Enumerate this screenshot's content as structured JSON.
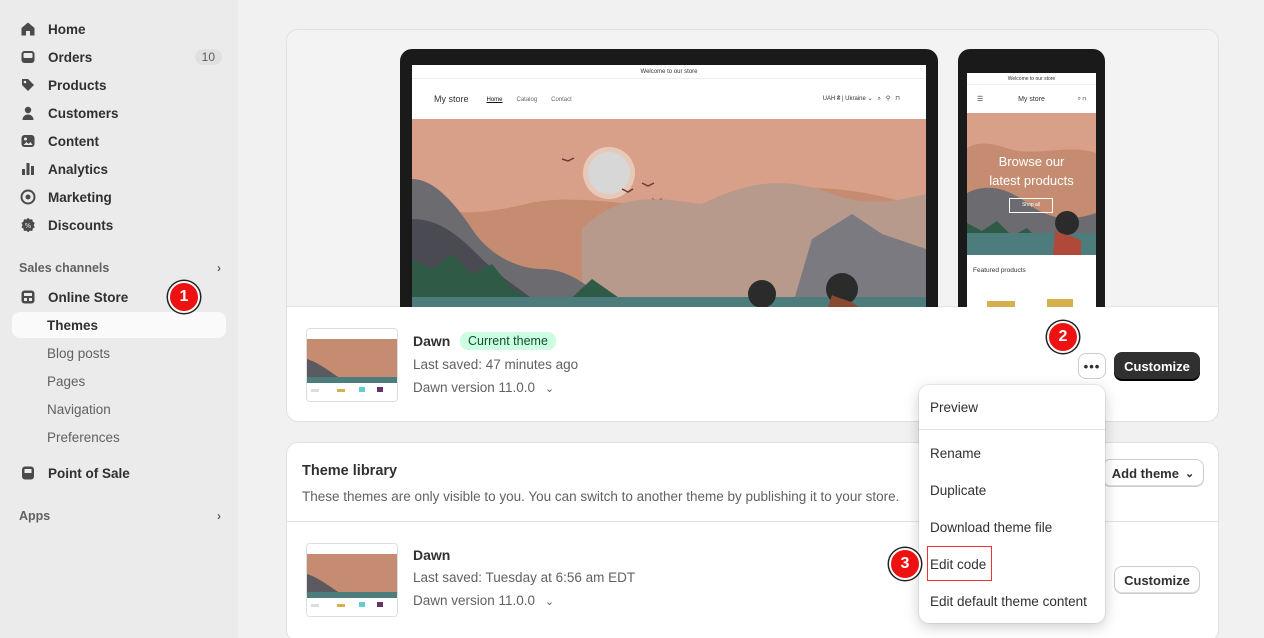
{
  "sidebar": {
    "items": [
      {
        "label": "Home",
        "icon": "home-icon"
      },
      {
        "label": "Orders",
        "icon": "inbox-icon",
        "badge": "10"
      },
      {
        "label": "Products",
        "icon": "tag-icon"
      },
      {
        "label": "Customers",
        "icon": "person-icon"
      },
      {
        "label": "Content",
        "icon": "image-icon"
      },
      {
        "label": "Analytics",
        "icon": "bar-chart-icon"
      },
      {
        "label": "Marketing",
        "icon": "target-icon"
      },
      {
        "label": "Discounts",
        "icon": "discount-icon"
      }
    ],
    "sales_channels_label": "Sales channels",
    "online_store_label": "Online Store",
    "sub_items": [
      "Themes",
      "Blog posts",
      "Pages",
      "Navigation",
      "Preferences"
    ],
    "pos_label": "Point of Sale",
    "apps_label": "Apps"
  },
  "steps": [
    "1",
    "2",
    "3"
  ],
  "preview": {
    "announcement": "Welcome to our store",
    "brand": "My store",
    "nav": [
      "Home",
      "Catalog",
      "Contact"
    ],
    "locale": "UAH ₴ | Ukraine",
    "mobile_announcement": "Welcome to our store",
    "mobile_brand": "My store",
    "mobile_hero_line1": "Browse our",
    "mobile_hero_line2": "latest products",
    "mobile_shop_btn": "Shop all",
    "featured": "Featured products"
  },
  "current_theme": {
    "name": "Dawn",
    "badge": "Current theme",
    "last_saved": "Last saved: 47 minutes ago",
    "version": "Dawn version 11.0.0",
    "customize_label": "Customize"
  },
  "library": {
    "title": "Theme library",
    "description": "These themes are only visible to you. You can switch to another theme by publishing it to your store.",
    "add_theme_label": "Add theme",
    "theme": {
      "name": "Dawn",
      "last_saved": "Last saved: Tuesday at 6:56 am EDT",
      "version": "Dawn version 11.0.0",
      "customize_label": "Customize"
    }
  },
  "menu": {
    "items": [
      "Preview",
      "Rename",
      "Duplicate",
      "Download theme file",
      "Edit code",
      "Edit default theme content"
    ]
  },
  "colors": {
    "accent_dark": "#303030",
    "badge_green": "#cdfee1",
    "step_red": "#ee1111"
  }
}
